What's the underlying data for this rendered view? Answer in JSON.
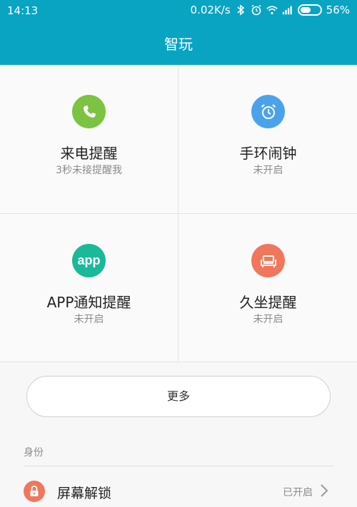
{
  "status_bar": {
    "time": "14:13",
    "speed": "0.02K/s",
    "battery": "56%",
    "battery_level": 0.56
  },
  "header": {
    "title": "智玩"
  },
  "features": [
    {
      "label": "来电提醒",
      "sub": "3秒未接提醒我",
      "icon": "phone-icon",
      "color": "#7cc341"
    },
    {
      "label": "手环闹钟",
      "sub": "未开启",
      "icon": "alarm-clock-icon",
      "color": "#4aa3ea"
    },
    {
      "label": "APP通知提醒",
      "sub": "未开启",
      "icon": "app-icon",
      "icon_text": "app",
      "color": "#19b99a"
    },
    {
      "label": "久坐提醒",
      "sub": "未开启",
      "icon": "sofa-icon",
      "color": "#f0775c"
    }
  ],
  "more_button": {
    "label": "更多"
  },
  "identity_section": {
    "title": "身份",
    "items": [
      {
        "label": "屏幕解锁",
        "status": "已开启",
        "icon": "lock-icon",
        "color": "#f0775c"
      }
    ]
  }
}
